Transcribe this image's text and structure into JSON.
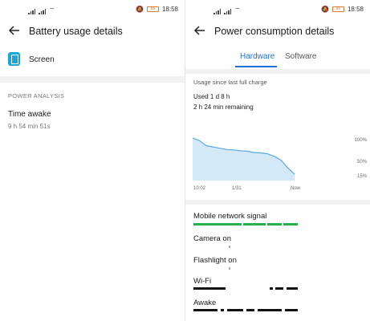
{
  "status_bar": {
    "time": "18:58",
    "battery_level": "85"
  },
  "left": {
    "title": "Battery usage details",
    "screen_label": "Screen",
    "section_header": "POWER ANALYSIS",
    "time_awake_label": "Time awake",
    "time_awake_value": "9 h 54 min 51s"
  },
  "right": {
    "title": "Power consumption details",
    "tabs": [
      {
        "label": "Hardware",
        "active": true
      },
      {
        "label": "Software",
        "active": false
      }
    ],
    "usage_header": "Usage since last full charge",
    "used": "Used 1 d 8 h",
    "remaining": "2 h 24 min remaining",
    "chart_labels": {
      "y_top": "100%",
      "y_mid": "50%",
      "y_low": "15%",
      "x_start": "10:02",
      "x_mid": "1/31",
      "x_end": "Now"
    },
    "hardware_items": [
      {
        "label": "Mobile network signal"
      },
      {
        "label": "Camera on"
      },
      {
        "label": "Flashlight on"
      },
      {
        "label": "Wi-Fi"
      },
      {
        "label": "Awake"
      }
    ]
  },
  "colors": {
    "accent": "#1f6fd6",
    "screen_icon": "#19a6d8",
    "signal_bar": "#2ab04a",
    "chart_line": "#5aa9de",
    "chart_fill": "#d4e9f8"
  },
  "chart_data": {
    "type": "area",
    "title": "",
    "xlabel": "",
    "ylabel": "",
    "x_tick_labels": [
      "10:02",
      "1/31",
      "Now"
    ],
    "y_tick_labels": [
      "100%",
      "50%",
      "15%"
    ],
    "ylim": [
      0,
      100
    ],
    "series": [
      {
        "values": [
          100,
          94,
          82,
          79,
          76,
          73,
          72,
          70,
          69,
          66,
          65,
          63,
          57,
          48,
          30,
          15
        ]
      }
    ],
    "grid": false,
    "legend": "none"
  }
}
